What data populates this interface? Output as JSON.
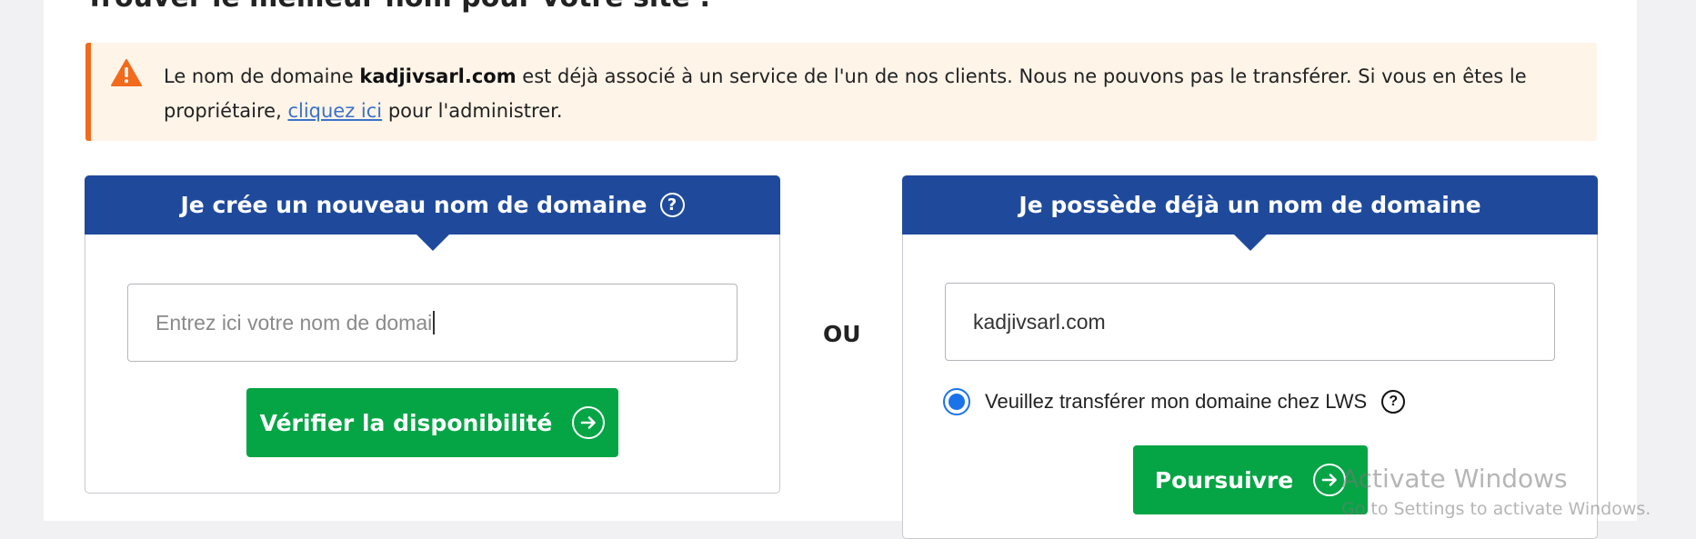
{
  "page": {
    "heading": "Trouver le meilleur nom pour votre site :"
  },
  "alert": {
    "icon": "warning-icon",
    "text_before": "Le nom de domaine ",
    "domain": "kadjivsarl.com",
    "text_middle": " est déjà associé à un service de l'un de nos clients. Nous ne pouvons pas le transférer. Si vous en êtes le propriétaire, ",
    "link": "cliquez ici",
    "text_after": " pour l'administrer."
  },
  "new_domain": {
    "title": "Je crée un nouveau nom de domaine",
    "help_icon": "help-circle-icon",
    "input_value": "Entrez ici votre nom de domai",
    "button_label": "Vérifier la disponibilité",
    "button_icon": "arrow-circle-right-icon"
  },
  "separator": "OU",
  "existing_domain": {
    "title": "Je possède déjà un nom de domaine",
    "input_value": "kadjivsarl.com",
    "radio_label": "Veuillez transférer mon domaine chez LWS",
    "radio_selected": true,
    "help_icon": "help-circle-icon",
    "button_label": "Poursuivre",
    "button_icon": "arrow-circle-right-icon"
  },
  "watermark": {
    "line1": "Activate Windows",
    "line2": "Go to Settings to activate Windows."
  },
  "colors": {
    "header_blue": "#1f4a9c",
    "button_green": "#05a545",
    "alert_bg": "#fff4e8",
    "alert_border": "#f26a1b",
    "link": "#3a72c9"
  }
}
